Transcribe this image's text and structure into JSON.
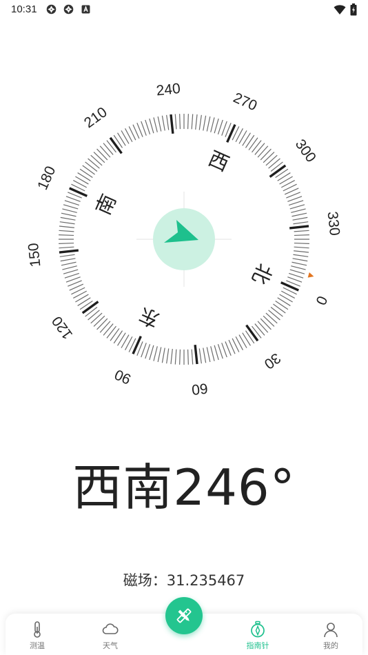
{
  "status_bar": {
    "time": "10:31",
    "left_icons": [
      "aperture-icon",
      "aperture-icon",
      "a-box-icon"
    ],
    "right_icons": [
      "wifi-icon",
      "battery-icon"
    ]
  },
  "compass": {
    "heading_degrees": 246,
    "degree_labels": [
      "0",
      "30",
      "60",
      "90",
      "120",
      "150",
      "180",
      "210",
      "240",
      "270",
      "300",
      "330"
    ],
    "cardinal_labels": {
      "north": "北",
      "east": "东",
      "south": "南",
      "west": "西"
    },
    "accent_color": "#1ec08d",
    "marker_color": "#e2751f"
  },
  "readout": {
    "heading_text": "西南246°",
    "magnetic_text": "磁场：31.235467"
  },
  "tabbar": {
    "tabs": [
      {
        "label": "测温",
        "icon": "thermometer-icon",
        "active": false
      },
      {
        "label": "天气",
        "icon": "cloud-icon",
        "active": false
      },
      {
        "label": "指南针",
        "icon": "compass-icon",
        "active": true
      },
      {
        "label": "我的",
        "icon": "person-icon",
        "active": false
      }
    ],
    "center_button_icon": "pencil-ruler-icon"
  }
}
